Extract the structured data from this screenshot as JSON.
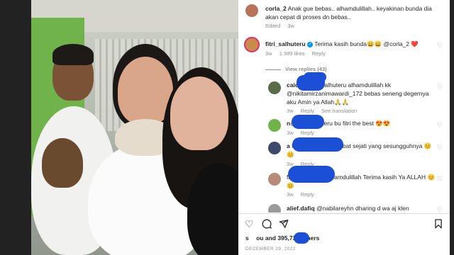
{
  "post": {
    "caption_author": {
      "username": "corla_2",
      "avatar_color": "#b9735a"
    },
    "caption_text": "Anak gue bebas.. alhamdulillah.. keyakinan bunda dia akan cepat di proses dn bebas..",
    "caption_meta": {
      "edited": "Edited",
      "time": "3w"
    }
  },
  "comments": [
    {
      "username": "fitri_salhuteru",
      "verified": true,
      "avatar_color": "#c98a4a",
      "text": "Terima kasih bunda😄😄 @corla_2 ❤️",
      "time": "3w",
      "likes": "1.989 likes",
      "reply": "Reply",
      "view_replies": "View replies (43)"
    }
  ],
  "replies": [
    {
      "username": "caion",
      "avatar_color": "#5a6b48",
      "text": "@fitri_salhuteru alhamdulillah kk @nikitamirzanimawardi_172 bebas seneng degernya aku Amin ya Allah🙏🙏",
      "time": "3w",
      "likes": "Reply",
      "extra": "See translation"
    },
    {
      "username": "n",
      "avatar_color": "#6fb34a",
      "text": "@fitri_salhuteru bu fitri the best 😍😍",
      "time": "3w",
      "likes": "Reply"
    },
    {
      "username": "a",
      "avatar_color": "#3d4a6b",
      "text": "fitri_salhuteru sahabat sejati yang sesungguhnya 😊😊",
      "time": "3w",
      "likes": "Reply"
    },
    {
      "username": "",
      "avatar_color": "#b88a7a",
      "text": "fitri_salhuteru Allhamdulillah Terima kasih Ya ALLAH 😊😊",
      "time": "3w",
      "likes": "Reply"
    },
    {
      "username": "alief.dafiq",
      "avatar_color": "#9a9a9a",
      "text": "@nabilareyhn dharing d wa aj klen",
      "time": "",
      "likes": ""
    }
  ],
  "footer": {
    "likes_text_prefix": "s",
    "likes_text": "ou and 395,735 others",
    "date": "DECEMBER 29, 2022"
  },
  "icons": {
    "like": "heart-icon",
    "comment": "comment-icon",
    "share": "send-icon",
    "save": "bookmark-icon"
  },
  "colors": {
    "mention": "#00376b",
    "muted": "#8e8e8e",
    "verified": "#0095f6",
    "blob": "#1a4fd6"
  }
}
